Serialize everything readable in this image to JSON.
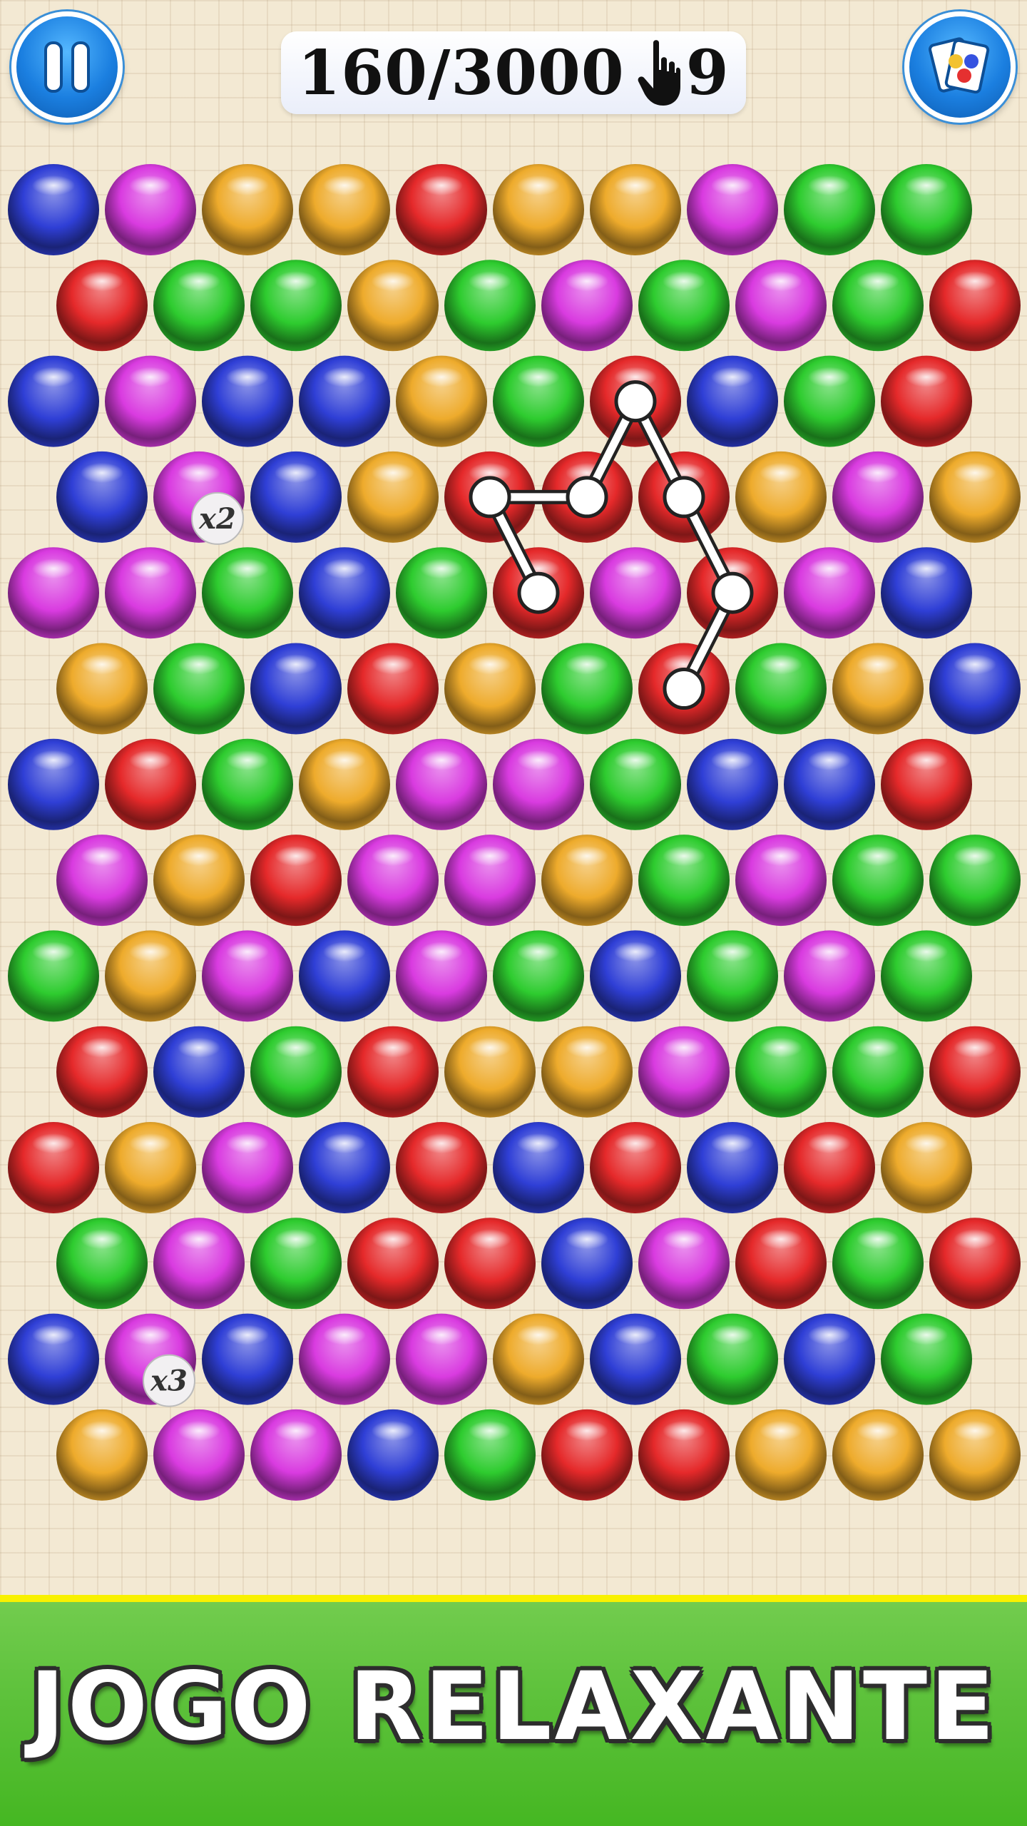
{
  "hud": {
    "score_text": "160/3000",
    "moves_text": "9",
    "pause_icon": "pause-icon",
    "hand_icon": "hand-pointer-icon",
    "cards_icon": "color-cards-icon"
  },
  "board": {
    "colors": {
      "B": "#2f3fd6",
      "M": "#d93be0",
      "O": "#eeab2c",
      "R": "#e5292a",
      "G": "#2ecc2f"
    },
    "rows": [
      [
        "B",
        "M",
        "O",
        "O",
        "R",
        "O",
        "O",
        "M",
        "G",
        "G"
      ],
      [
        "R",
        "G",
        "G",
        "O",
        "G",
        "M",
        "G",
        "M",
        "G",
        "R"
      ],
      [
        "B",
        "M",
        "B",
        "B",
        "O",
        "G",
        "R",
        "B",
        "G",
        "R"
      ],
      [
        "B",
        "M",
        "B",
        "O",
        "R",
        "R",
        "R",
        "O",
        "M",
        "O"
      ],
      [
        "M",
        "M",
        "G",
        "B",
        "G",
        "R",
        "M",
        "R",
        "M",
        "B"
      ],
      [
        "O",
        "G",
        "B",
        "R",
        "O",
        "G",
        "R",
        "G",
        "O",
        "B"
      ],
      [
        "B",
        "R",
        "G",
        "O",
        "M",
        "M",
        "G",
        "B",
        "B",
        "R"
      ],
      [
        "M",
        "O",
        "R",
        "M",
        "M",
        "O",
        "G",
        "M",
        "G",
        "G"
      ],
      [
        "G",
        "O",
        "M",
        "B",
        "M",
        "G",
        "B",
        "G",
        "M",
        "G"
      ],
      [
        "R",
        "B",
        "G",
        "R",
        "O",
        "O",
        "M",
        "G",
        "G",
        "R"
      ],
      [
        "R",
        "O",
        "M",
        "B",
        "R",
        "B",
        "R",
        "B",
        "R",
        "O"
      ],
      [
        "G",
        "M",
        "G",
        "R",
        "R",
        "B",
        "M",
        "R",
        "G",
        "R"
      ],
      [
        "B",
        "M",
        "B",
        "M",
        "M",
        "O",
        "B",
        "G",
        "B",
        "G"
      ],
      [
        "O",
        "M",
        "M",
        "B",
        "G",
        "R",
        "R",
        "O",
        "O",
        "O"
      ]
    ],
    "multipliers": [
      {
        "row": 3,
        "col": 1,
        "label": "x2"
      },
      {
        "row": 12,
        "col": 1,
        "label": "x3"
      }
    ],
    "selected_path": [
      [
        4,
        5
      ],
      [
        3,
        4
      ],
      [
        3,
        5
      ],
      [
        2,
        6
      ],
      [
        3,
        6
      ],
      [
        4,
        7
      ],
      [
        5,
        6
      ]
    ]
  },
  "banner": {
    "text": "JOGO RELAXANTE"
  }
}
